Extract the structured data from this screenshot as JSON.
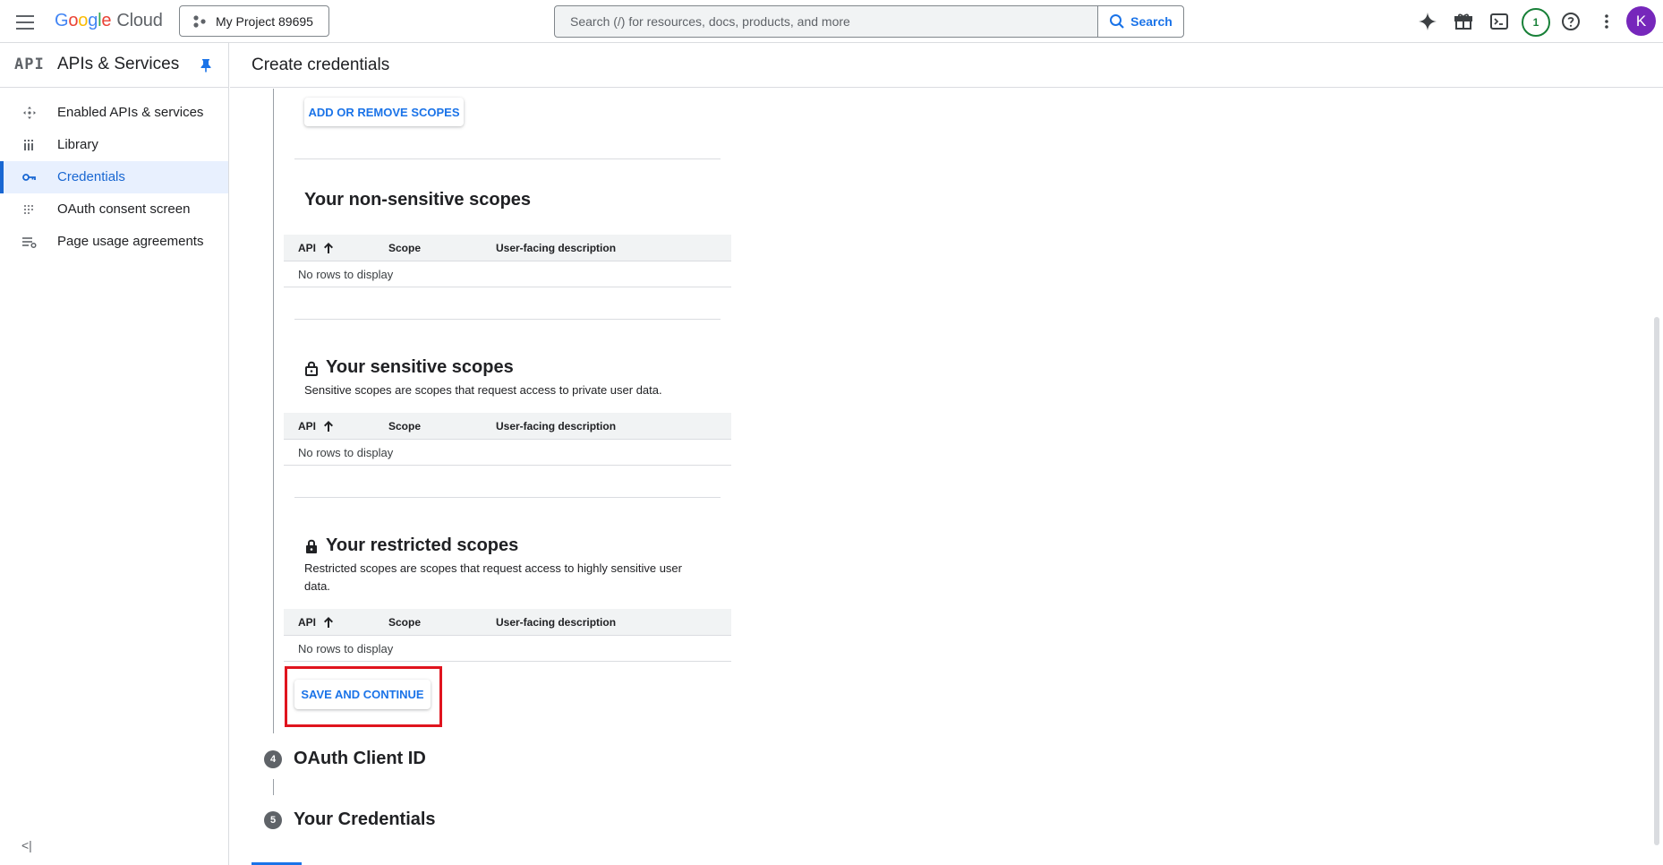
{
  "topbar": {
    "brand_google": [
      "G",
      "o",
      "o",
      "g",
      "l",
      "e"
    ],
    "brand_cloud": "Cloud",
    "project_name": "My Project 89695",
    "search_placeholder": "Search (/) for resources, docs, products, and more",
    "search_button": "Search",
    "notification_count": "1",
    "avatar_letter": "K"
  },
  "sidebar": {
    "logo_text": "API",
    "title": "APIs & Services",
    "items": [
      {
        "label": "Enabled APIs & services",
        "icon": "enabled-apis-icon"
      },
      {
        "label": "Library",
        "icon": "library-icon"
      },
      {
        "label": "Credentials",
        "icon": "key-icon",
        "active": true
      },
      {
        "label": "OAuth consent screen",
        "icon": "oauth-icon"
      },
      {
        "label": "Page usage agreements",
        "icon": "settings-list-icon"
      }
    ],
    "collapse_label": "<|"
  },
  "page": {
    "title": "Create credentials"
  },
  "content": {
    "add_scopes_button": "ADD OR REMOVE SCOPES",
    "non_sensitive": {
      "title": "Your non-sensitive scopes",
      "columns": [
        "API",
        "Scope",
        "User-facing description"
      ],
      "empty": "No rows to display"
    },
    "sensitive": {
      "title": "Your sensitive scopes",
      "description": "Sensitive scopes are scopes that request access to private user data.",
      "columns": [
        "API",
        "Scope",
        "User-facing description"
      ],
      "empty": "No rows to display"
    },
    "restricted": {
      "title": "Your restricted scopes",
      "description": "Restricted scopes are scopes that request access to highly sensitive user data.",
      "columns": [
        "API",
        "Scope",
        "User-facing description"
      ],
      "empty": "No rows to display"
    },
    "save_button": "SAVE AND CONTINUE",
    "steps": [
      {
        "num": "4",
        "label": "OAuth Client ID"
      },
      {
        "num": "5",
        "label": "Your Credentials"
      }
    ]
  },
  "colors": {
    "accent": "#1a73e8",
    "active_nav_bg": "#e8f0fe",
    "highlight_border": "#e0141e",
    "avatar_bg": "#7627bb"
  }
}
